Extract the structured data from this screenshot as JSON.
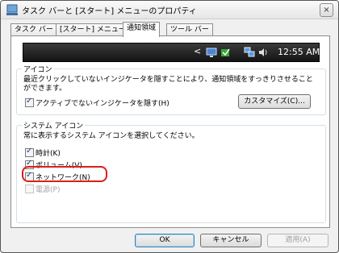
{
  "window": {
    "title": "タスク バーと [スタート] メニューのプロパティ",
    "close_label": "×"
  },
  "tabs": [
    {
      "label": "タスク バー",
      "active": false
    },
    {
      "label": "[スタート] メニュー",
      "active": false
    },
    {
      "label": "通知領域",
      "active": true
    },
    {
      "label": "ツール バー",
      "active": false
    }
  ],
  "preview": {
    "arrow": "<",
    "clock": "12:55 AM",
    "icons": [
      "monitor-icon",
      "volume-icon",
      "network-icon",
      "speaker-icon"
    ]
  },
  "icons_group": {
    "title": "アイコン",
    "description": "最近クリックしていないインジケータを隠すことにより、通知領域をすっきりさせることができます。",
    "hide_inactive": {
      "label": "アクティブでないインジケータを隠す(H)",
      "checked": true
    },
    "customize_button": "カスタマイズ(C)..."
  },
  "system_group": {
    "title": "システム アイコン",
    "description": "常に表示するシステム アイコンを選択してください。",
    "items": [
      {
        "label": "時計(K)",
        "checked": true,
        "enabled": true
      },
      {
        "label": "ボリューム(V)",
        "checked": true,
        "enabled": true
      },
      {
        "label": "ネットワーク(N)",
        "checked": true,
        "enabled": true
      },
      {
        "label": "電源(P)",
        "checked": false,
        "enabled": false
      }
    ]
  },
  "buttons": {
    "ok": "OK",
    "cancel": "キャンセル",
    "apply": "適用(A)"
  }
}
